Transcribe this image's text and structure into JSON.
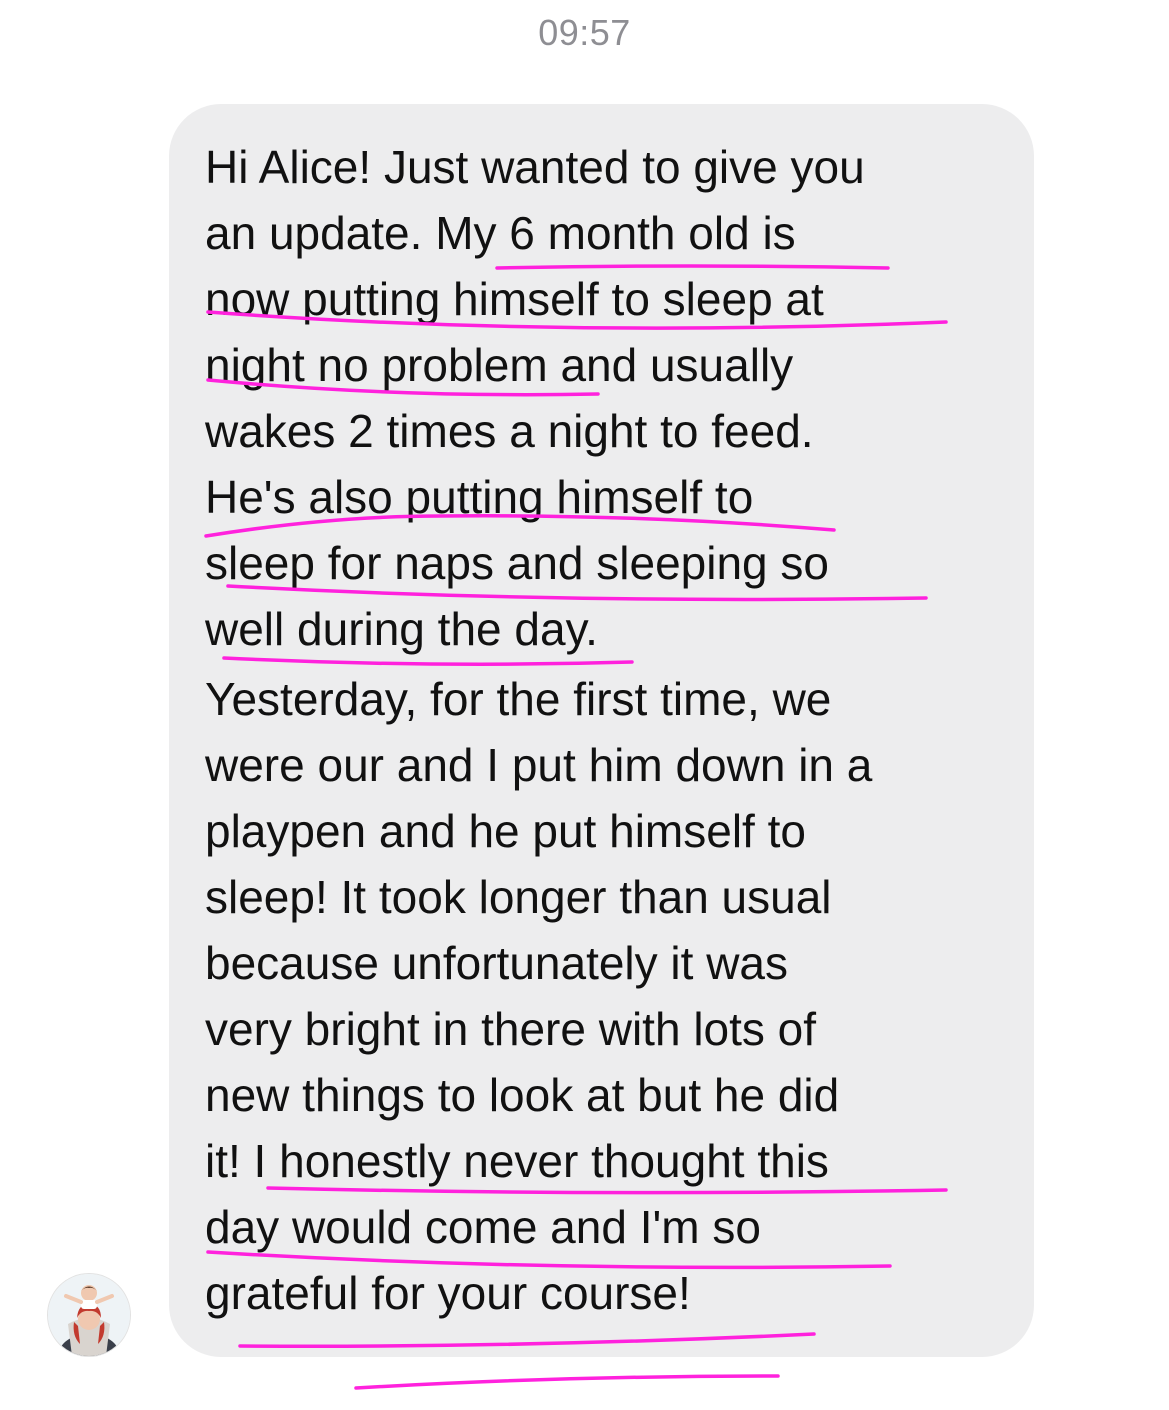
{
  "thread": {
    "timestamp": "09:57"
  },
  "message": {
    "sender_avatar": "avatar-photo",
    "lines": [
      "Hi Alice! Just wanted to give you",
      "an update. My 6 month old is",
      "now putting himself to sleep at",
      "night no problem and usually",
      "wakes 2 times a night to feed.",
      "He's also putting himself to",
      "sleep for naps and sleeping so",
      "well during the day.",
      "Yesterday, for the first time, we",
      "were our and I put him down in a",
      "playpen and he put himself to",
      "sleep! It took longer than usual",
      "because unfortunately it was",
      "very bright in there with lots of",
      "new things to look at but he did",
      "it! I honestly never thought this",
      "day would come and I'm so",
      "grateful for your course!"
    ]
  },
  "colors": {
    "bubble_background": "#ededee",
    "text": "#111111",
    "timestamp": "#8e8e93",
    "highlight_underline": "#ff22dd"
  }
}
